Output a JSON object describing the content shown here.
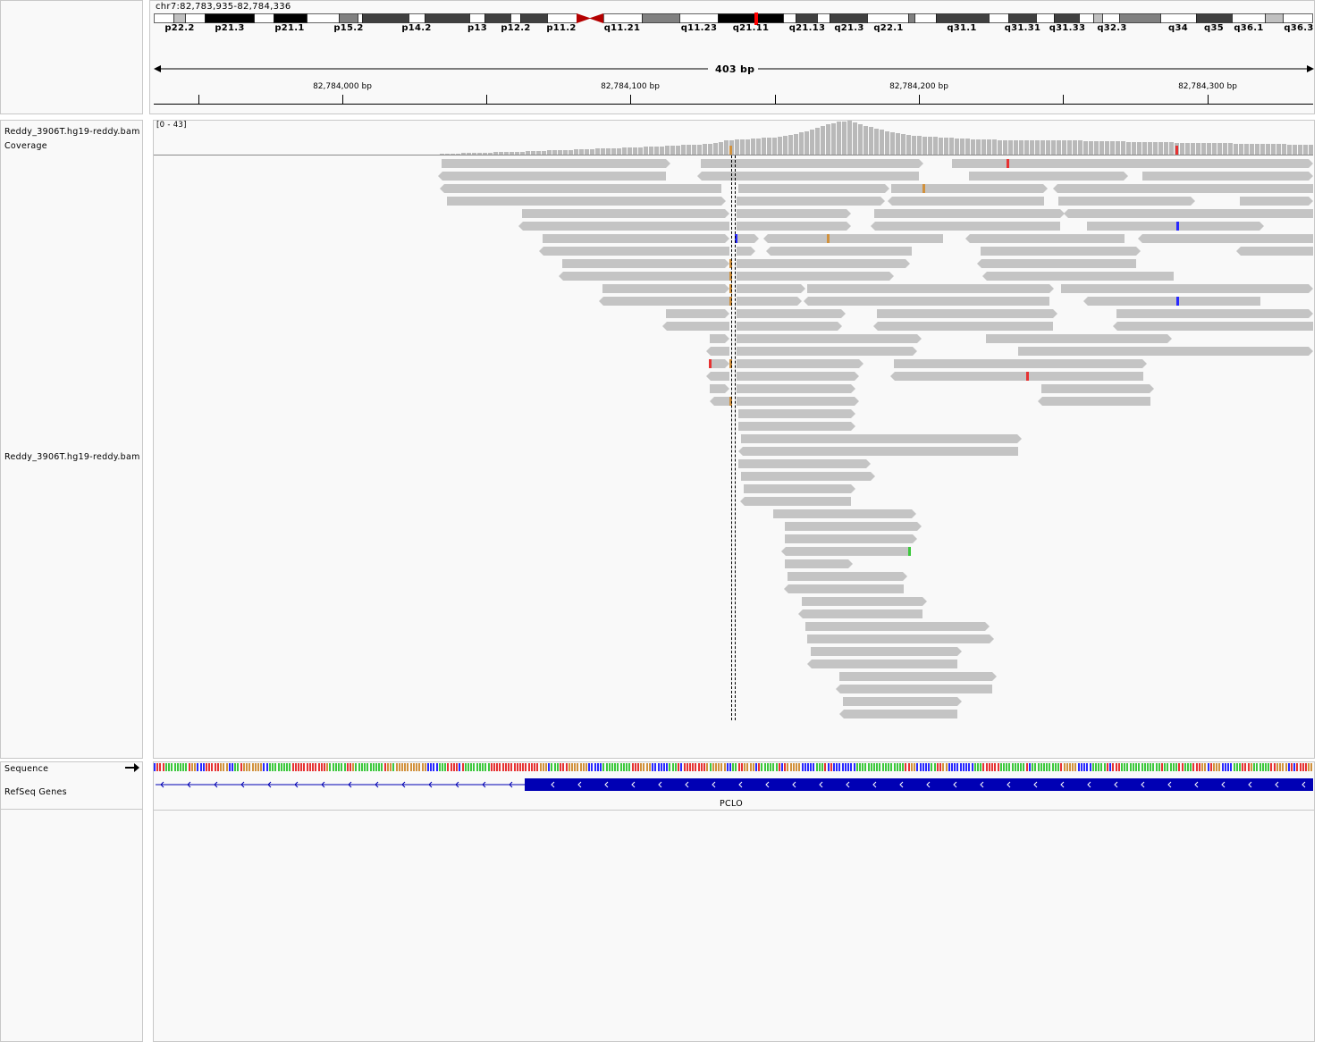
{
  "locus": "chr7:82,783,935-82,784,336",
  "ideogram": {
    "bands": [
      "p22.2",
      "p21.3",
      "p21.1",
      "p15.2",
      "p14.2",
      "p13",
      "p12.2",
      "p11.2",
      "q11.21",
      "q11.23",
      "q21.11",
      "q21.13",
      "q21.3",
      "q22.1",
      "q31.1",
      "q31.31",
      "q31.33",
      "q32.3",
      "q34",
      "q35",
      "q36.1",
      "q36.3"
    ]
  },
  "ruler": {
    "span": "403 bp",
    "ticks": [
      "82,784,000 bp",
      "82,784,100 bp",
      "82,784,200 bp",
      "82,784,300 bp"
    ]
  },
  "tracks": {
    "coverage_name": "Reddy_3906T.hg19-reddy.bam Coverage",
    "coverage_range": "[0 - 43]",
    "alignment_name": "Reddy_3906T.hg19-reddy.bam",
    "sequence_name": "Sequence",
    "genes_name": "RefSeq Genes",
    "gene_symbol": "PCLO"
  },
  "colors": {
    "read": "#c4c4c4",
    "coverage": "#b9b9b9",
    "gene": "#0000b4",
    "mismatch_A": "#3cc83c",
    "mismatch_C": "#2828ff",
    "mismatch_G": "#d1913c",
    "mismatch_T": "#e63232",
    "centromere": "#b40000"
  },
  "icons": {
    "sequence_strand": "right-arrow-icon",
    "gene_strand": "chevron-left-icon"
  }
}
